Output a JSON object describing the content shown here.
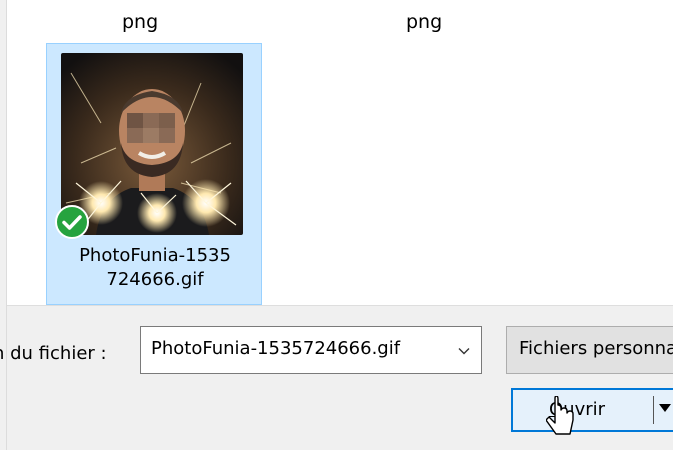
{
  "file_list": {
    "column_labels": [
      "png",
      "png"
    ],
    "selected_item": {
      "name": "PhotoFunia-1535724666.gif",
      "name_line1": "PhotoFunia-1535",
      "name_line2": "724666.gif",
      "status_icon": "check-icon",
      "thumbnail_icon": "person-photo"
    }
  },
  "footer": {
    "filename_label": "n du fichier :",
    "filename_value": "PhotoFunia-1535724666.gif",
    "filetype_value": "Fichiers personnalisés",
    "open_label_first": "O",
    "open_label_rest": "uvrir"
  },
  "colors": {
    "selection_bg": "#cce8ff",
    "selection_border": "#99d1ff",
    "button_focus_border": "#0078d7",
    "check_green": "#26a33f"
  }
}
